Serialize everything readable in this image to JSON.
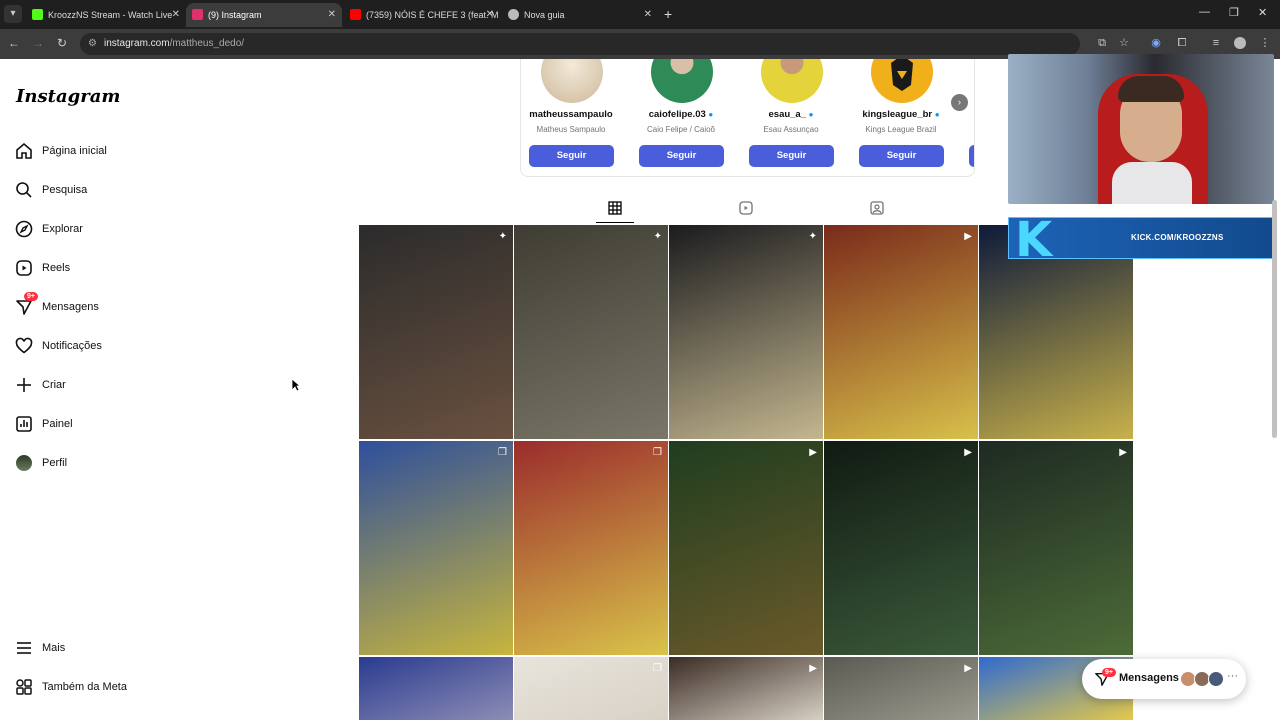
{
  "browser": {
    "tabs": [
      {
        "title": "KroozzNS Stream - Watch Live",
        "favicon_color": "#53fc18"
      },
      {
        "title": "(9) Instagram",
        "favicon_color": "#e1306c"
      },
      {
        "title": "(7359) NÓIS É CHEFE 3 (feat. M",
        "favicon_color": "#ff0000"
      },
      {
        "title": "Nova guia",
        "favicon_color": "#bbbbbb"
      }
    ],
    "url_host": "instagram.com",
    "url_path": "/mattheus_dedo/"
  },
  "sidebar": {
    "logo": "Instagram",
    "items": [
      {
        "label": "Página inicial",
        "icon": "home-icon"
      },
      {
        "label": "Pesquisa",
        "icon": "search-icon"
      },
      {
        "label": "Explorar",
        "icon": "compass-icon"
      },
      {
        "label": "Reels",
        "icon": "reels-icon"
      },
      {
        "label": "Mensagens",
        "icon": "messenger-icon",
        "badge": "9+"
      },
      {
        "label": "Notificações",
        "icon": "heart-icon"
      },
      {
        "label": "Criar",
        "icon": "plus-icon"
      },
      {
        "label": "Painel",
        "icon": "chart-icon"
      },
      {
        "label": "Perfil",
        "icon": "avatar"
      }
    ],
    "bottom": [
      {
        "label": "Mais",
        "icon": "menu-icon"
      },
      {
        "label": "Também da Meta",
        "icon": "meta-apps-icon"
      }
    ]
  },
  "suggestions": [
    {
      "username": "matheussampaulo",
      "name": "Matheus Sampaulo",
      "verified": false,
      "follow": "Seguir",
      "avatar_color": "#d9c4a6"
    },
    {
      "username": "caiofelipe.03",
      "name": "Caio Felipe / Caioõ",
      "verified": true,
      "follow": "Seguir",
      "avatar_color": "#2e8b57"
    },
    {
      "username": "esau_a_",
      "name": "Esau Assunçao",
      "verified": true,
      "follow": "Seguir",
      "avatar_color": "#e4d33a"
    },
    {
      "username": "kingsleague_br",
      "name": "Kings League Brazil",
      "verified": true,
      "follow": "Seguir",
      "avatar_color": "#f1b01a"
    }
  ],
  "profile_tabs": [
    "grid-icon",
    "reels-icon",
    "tagged-icon"
  ],
  "posts": [
    {
      "overlay": "pin-icon",
      "colors": [
        "#2b2b2b",
        "#6a5140"
      ]
    },
    {
      "overlay": "pin-icon",
      "colors": [
        "#3f3d33",
        "#7a7768"
      ]
    },
    {
      "overlay": "pin-icon",
      "colors": [
        "#1b1b1e",
        "#c4b78f"
      ]
    },
    {
      "overlay": "reel-icon",
      "colors": [
        "#7a2a1a",
        "#d8c04a"
      ]
    },
    {
      "overlay": "carousel-icon",
      "colors": [
        "#0d1a3a",
        "#c8b14a"
      ]
    },
    {
      "overlay": "carousel-icon",
      "colors": [
        "#2e4f9c",
        "#c7b53d"
      ]
    },
    {
      "overlay": "carousel-icon",
      "colors": [
        "#9b2c2c",
        "#d9c34a"
      ]
    },
    {
      "overlay": "reel-icon",
      "colors": [
        "#1f3d1f",
        "#6b5a2a"
      ]
    },
    {
      "overlay": "reel-icon",
      "colors": [
        "#101a12",
        "#3b5a3a"
      ]
    },
    {
      "overlay": "reel-icon",
      "colors": [
        "#1d2a22",
        "#4d6b38"
      ]
    },
    {
      "overlay": "",
      "colors": [
        "#2a3b8f",
        "#8d8db5"
      ]
    },
    {
      "overlay": "carousel-icon",
      "colors": [
        "#e8e4dc",
        "#d8d2c6"
      ]
    },
    {
      "overlay": "reel-icon",
      "colors": [
        "#3a2c24",
        "#d7cfc4"
      ]
    },
    {
      "overlay": "reel-icon",
      "colors": [
        "#5a5a52",
        "#9a9a8e"
      ]
    },
    {
      "overlay": "",
      "colors": [
        "#2f6ad0",
        "#e3c84a"
      ]
    }
  ],
  "stream": {
    "kick_letter": "K",
    "kick_url": "KICK.COM/KROOZZNS"
  },
  "messages_pill": {
    "label": "Mensagens",
    "badge": "9+",
    "avatars": [
      "#c98f6d",
      "#8a6a58",
      "#4a5a7a"
    ]
  }
}
